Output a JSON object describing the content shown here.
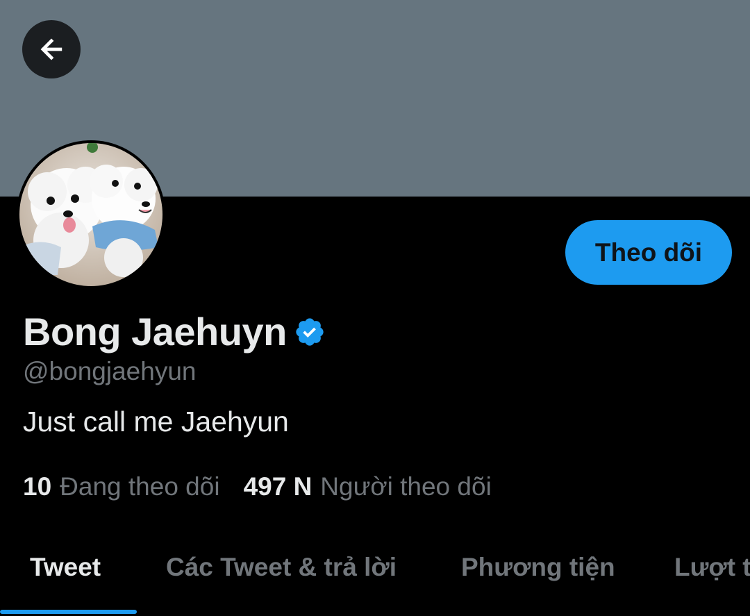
{
  "header": {
    "back_icon": "arrow-left-icon",
    "banner_color": "#66757f"
  },
  "profile": {
    "avatar_description": "two-white-dogs-photo",
    "display_name": "Bong Jaehuyn",
    "verified_icon": "verified-badge-icon",
    "handle": "@bongjaehyun",
    "bio": "Just call me Jaehyun",
    "follow_label": "Theo dõi",
    "stats": {
      "following_count": "10",
      "following_label": "Đang theo dõi",
      "followers_count": "497 N",
      "followers_label": "Người theo dõi"
    }
  },
  "tabs": [
    {
      "label": "Tweet",
      "active": true
    },
    {
      "label": "Các Tweet & trả lời",
      "active": false
    },
    {
      "label": "Phương tiện",
      "active": false
    },
    {
      "label": "Lượt thích",
      "active": false
    }
  ],
  "colors": {
    "accent": "#1d9bf0",
    "background": "#000000",
    "text_primary": "#e7e9ea",
    "text_secondary": "#71767b"
  }
}
